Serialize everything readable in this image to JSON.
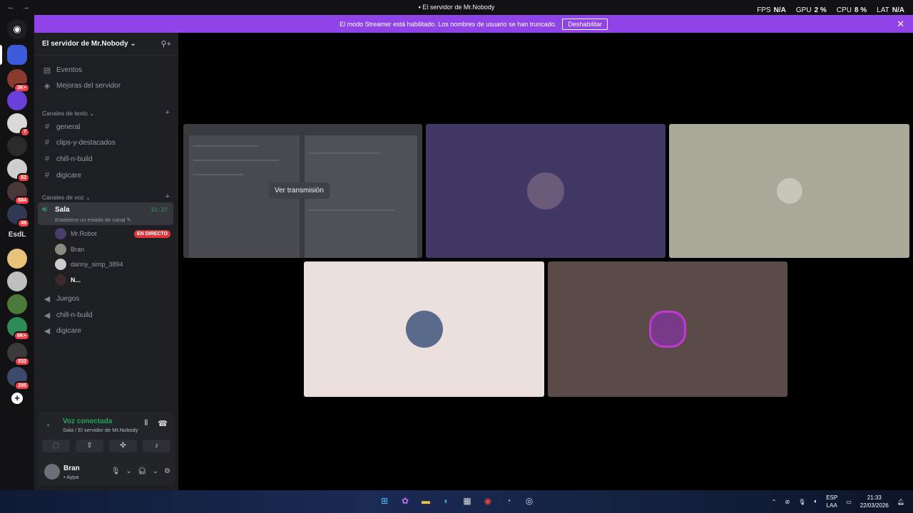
{
  "window": {
    "title": "El servidor de Mr.Nobody",
    "back": "←",
    "forward": "→",
    "stats": [
      {
        "label": "FPS",
        "value": "N/A"
      },
      {
        "label": "GPU",
        "value": "2 %"
      },
      {
        "label": "CPU",
        "value": "8 %"
      },
      {
        "label": "LAT",
        "value": "N/A"
      }
    ]
  },
  "banner": {
    "message": "El modo Streamer está habilitado. Los nombres de usuario se han truncado.",
    "button": "Deshabilitar"
  },
  "guilds": {
    "text_icon": "EsdL",
    "badges": [
      "3K+",
      "7",
      "62",
      "684",
      "49",
      "6K+",
      "532",
      "295"
    ],
    "home_icon": "discord-icon",
    "add_icon": "+"
  },
  "sidebar": {
    "server_name": "El servidor de Mr.Nobody",
    "top_items": [
      {
        "label": "Eventos",
        "icon": "calendar-icon"
      },
      {
        "label": "Mejoras del servidor",
        "icon": "boost-icon"
      }
    ],
    "text_category": "Canales de texto",
    "text_channels": [
      "general",
      "clips-y-destacados",
      "chill-n-build",
      "digicare"
    ],
    "voice_category": "Canales de voz",
    "active_voice": {
      "name": "Sala",
      "time": "31:37",
      "status": "Establece un estado de canal"
    },
    "members": [
      {
        "name": "Mr.Robot",
        "live": "EN DIRECTO"
      },
      {
        "name": "Bran"
      },
      {
        "name": "danny_simp_3894"
      },
      {
        "name": "N..."
      }
    ],
    "voice_channels": [
      "Juegos",
      "chill-n-build",
      "digicare"
    ]
  },
  "voice_panel": {
    "title": "Voz conectada",
    "subtitle": "Sala / El servidor de Mr.Nobody"
  },
  "user": {
    "name": "Bran",
    "status": "• Aypa"
  },
  "stage": {
    "watch_stream": "Ver transmisión",
    "tile_colors": [
      "#433766",
      "#aaa898",
      "#ebe0dd",
      "#5a4a48"
    ]
  },
  "taskbar": {
    "lang_top": "ESP",
    "lang_bottom": "LAA",
    "time": "21:33",
    "date": "22/03/2026"
  }
}
